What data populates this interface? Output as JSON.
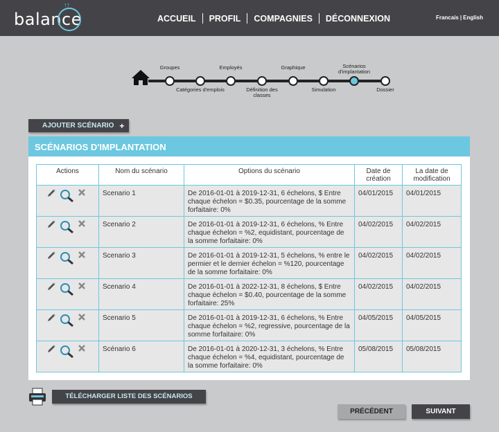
{
  "header": {
    "logo": "balance",
    "nav": [
      "ACCUEIL",
      "PROFIL",
      "COMPAGNIES",
      "DÉCONNEXION"
    ],
    "lang": {
      "fr": "Francais",
      "en": "English"
    }
  },
  "stepper": {
    "steps": [
      {
        "label": "Groupes",
        "pos": "top"
      },
      {
        "label": "Catégories d'emplois",
        "pos": "bottom"
      },
      {
        "label": "Employés",
        "pos": "top"
      },
      {
        "label": "Définition des classes",
        "pos": "bottom"
      },
      {
        "label": "Graphique",
        "pos": "top"
      },
      {
        "label": "Simulation",
        "pos": "bottom"
      },
      {
        "label": "Scénarios d'implantation",
        "pos": "top",
        "active": true
      },
      {
        "label": "Dossier",
        "pos": "bottom"
      }
    ]
  },
  "add_button": {
    "label": "AJOUTER SCÉNARIO",
    "icon": "+"
  },
  "panel": {
    "title": "SCÉNARIOS D'IMPLANTATION",
    "columns": [
      "Actions",
      "Nom du scénario",
      "Options du scénario",
      "Date de création",
      "La date de modification"
    ],
    "rows": [
      {
        "name": "Scenario 1",
        "options": "De 2016-01-01 à 2019-12-31, 6 échelons, $ Entre chaque échelon = $0.35, pourcentage de la somme forfaitaire: 0%",
        "created": "04/01/2015",
        "modified": "04/01/2015"
      },
      {
        "name": "Scenario 2",
        "options": "De 2016-01-01 à 2019-12-31, 6 échelons, % Entre chaque échelon = %2, equidistant, pourcentage de la somme forfaitaire: 0%",
        "created": "04/02/2015",
        "modified": "04/02/2015"
      },
      {
        "name": "Scenario 3",
        "options": "De 2016-01-01 à 2019-12-31, 5 échelons, % entre le permier et le dernier échelon = %120, pourcentage de la somme forfaitaire: 0%",
        "created": "04/02/2015",
        "modified": "04/02/2015"
      },
      {
        "name": "Scenario 4",
        "options": "De 2016-01-01 à 2022-12-31, 8 échelons, $ Entre chaque échelon = $0.40, pourcentage de la somme forfaitaire: 25%",
        "created": "04/02/2015",
        "modified": "04/02/2015"
      },
      {
        "name": "Scenario 5",
        "options": "De 2016-01-01 à 2019-12-31, 6 échelons, % Entre chaque échelon = %2, regressive, pourcentage de la somme forfaitaire: 0%",
        "created": "04/05/2015",
        "modified": "04/05/2015"
      },
      {
        "name": "Scénario 6",
        "options": "De 2016-01-01 à 2020-12-31, 3 échelons, % Entre chaque échelon = %4, equidistant, pourcentage de la somme forfaitaire: 0%",
        "created": "05/08/2015",
        "modified": "05/08/2015"
      }
    ]
  },
  "download_button": "TÉLÉCHARGER LISTE DES SCÉNARIOS",
  "prev_button": "PRÉCÉDENT",
  "next_button": "SUIVANT",
  "colors": {
    "accent": "#6cc7e0",
    "dark": "#444448",
    "background": "#c9cacb",
    "row": "#e7e7e8"
  }
}
